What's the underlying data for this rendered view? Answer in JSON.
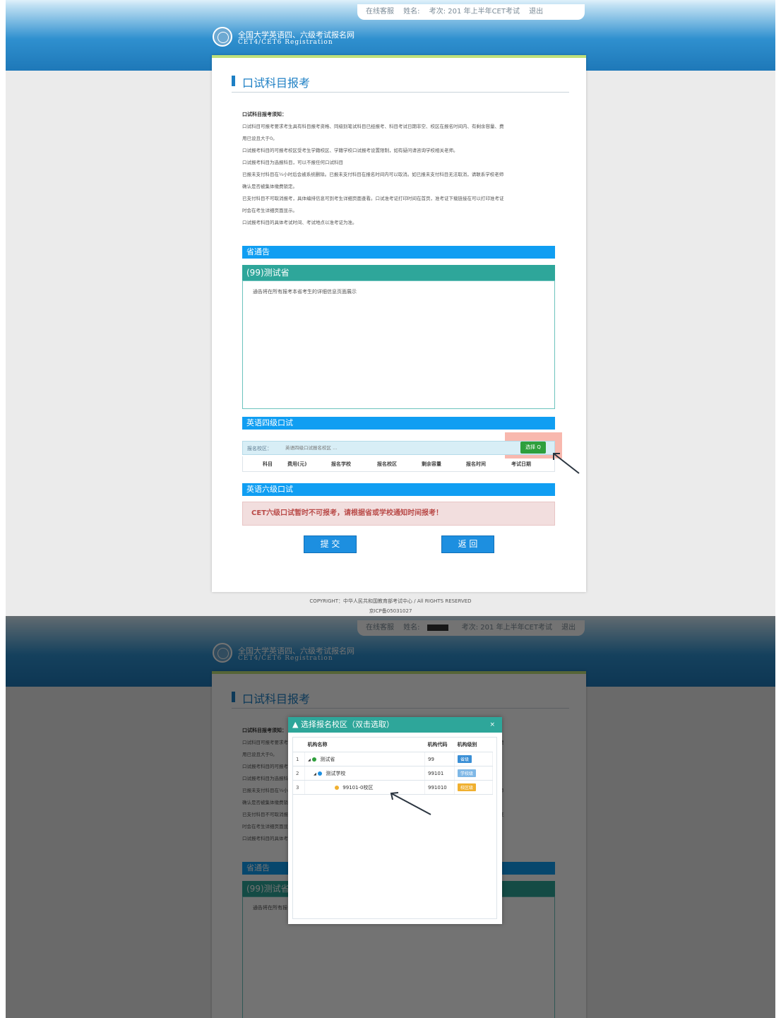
{
  "topbar": {
    "online": "在线客服",
    "name_label": "姓名:",
    "exam": "考次: 201  年上半年CET考试",
    "logout": "退出"
  },
  "site": {
    "title_cn": "全国大学英语四、六级考试报名网",
    "title_en": "CET4/CET6 Registration"
  },
  "page": {
    "title": "口试科目报考"
  },
  "notice": {
    "heading": "口试科目报考须知：",
    "lines": [
      "口试科目可报考要求考生具有科目报考资格、同级别笔试科目已经报考、科目考试日期非空、校区在报名时间内、有剩余容量、费",
      "用已设且大于0。",
      "口试报考科目的可报考校区受考生学籍校区、学籍学校口试报考设置限制，如有疑问请咨询学校相关老师。",
      "口试报考科目为选报科目，可以不报任何口试科目",
      "已报未支付科目在½小时后会被系统删除。已报未支付科目在报名时间内可以取消。如已报未支付科目无法取消，请联系学校老师",
      "确认是否被集体缴费锁定。",
      "已支付科目不可取消报考，具体编排信息可到考生详细页面查看。口试准考证打印时间在首页，准考证下载链接在可以打印准考证",
      "时会在考生详细页面显示。",
      "口试报考科目的具体考试时间、考试地点以准考证为准。"
    ]
  },
  "province_notice": {
    "bar": "省通告",
    "province": "(99)测试省",
    "text": "通告将在所有报考本省考生的详细信息页面展示"
  },
  "cet4": {
    "bar": "英语四级口试",
    "campus_label": "报名校区：",
    "campus_placeholder": "英语四级口试报名校区 ...",
    "select_button": "选择 Q",
    "columns": [
      "科目",
      "费用(元)",
      "报名学校",
      "报名校区",
      "剩余容量",
      "报名时间",
      "考试日期"
    ]
  },
  "cet6": {
    "bar": "英语六级口试",
    "alert": "CET六级口试暂时不可报考，请根据省或学校通知时间报考！"
  },
  "actions": {
    "submit": "提 交",
    "back": "返 回"
  },
  "footer": {
    "copyright": "COPYRIGHT：中华人民共和国教育部考试中心 / All RIGHTS RESERVED",
    "icp": "京ICP备05031027"
  },
  "modal": {
    "title": "选择报名校区（双击选取）",
    "close": "×",
    "columns": [
      "机构名称",
      "机构代码",
      "机构级别"
    ],
    "rows": [
      {
        "index": "1",
        "name": "测试省",
        "code": "99",
        "level": "省级"
      },
      {
        "index": "2",
        "name": "测试学校",
        "code": "99101",
        "level": "学校级"
      },
      {
        "index": "3",
        "name": "99101-0校区",
        "code": "991010",
        "level": "校区级"
      }
    ]
  },
  "colors": {
    "brand_blue": "#1d7fc4",
    "bar_blue": "#109ef2",
    "teal": "#2ea69a",
    "select_green": "#2e9f3c",
    "alert_red": "#b94a48"
  }
}
